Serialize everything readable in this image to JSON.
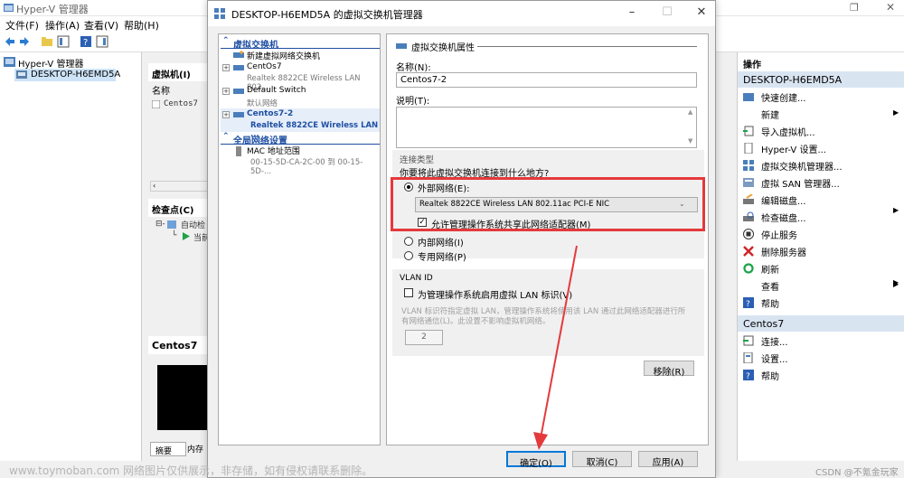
{
  "bg_window": {
    "title": "Hyper-V 管理器",
    "menu": [
      "文件(F)",
      "操作(A)",
      "查看(V)",
      "帮助(H)"
    ],
    "tree_root": "Hyper-V 管理器",
    "tree_host": "DESKTOP-H6EMD5A",
    "vm_panel_title": "虚拟机(I)",
    "vm_col_name": "名称",
    "vm_row": "Centos7",
    "checkpoint_title": "检查点(C)",
    "checkpoint_item": "自动检",
    "checkpoint_sub": "当前",
    "detail_title": "Centos7",
    "detail_tab1": "摘要",
    "detail_tab2": "内存"
  },
  "actions": {
    "header": "操作",
    "host_header": "DESKTOP-H6EMD5A",
    "host_items": [
      "快速创建...",
      "新建",
      "导入虚拟机...",
      "Hyper-V 设置...",
      "虚拟交换机管理器...",
      "虚拟 SAN 管理器...",
      "编辑磁盘...",
      "检查磁盘...",
      "停止服务",
      "删除服务器",
      "刷新",
      "查看",
      "帮助"
    ],
    "vm_header": "Centos7",
    "vm_items": [
      "连接...",
      "设置...",
      "帮助"
    ]
  },
  "dialog": {
    "title": "DESKTOP-H6EMD5A 的虚拟交换机管理器",
    "left": {
      "group1": "虚拟交换机",
      "new_switch": "新建虚拟网络交换机",
      "sw1_name": "CentOs7",
      "sw1_sub": "Realtek 8822CE Wireless LAN 802....",
      "sw2_name": "Default Switch",
      "sw2_sub": "默认网络",
      "sw3_name": "Centos7-2",
      "sw3_sub": "Realtek 8822CE Wireless LAN ...",
      "group2": "全局网络设置",
      "mac_name": "MAC 地址范围",
      "mac_sub": "00-15-5D-CA-2C-00 到 00-15-5D-..."
    },
    "right": {
      "section_title": "虚拟交换机属性",
      "name_label": "名称(N):",
      "name_value": "Centos7-2",
      "notes_label": "说明(T):",
      "conn_type_label": "连接类型",
      "conn_question": "你要将此虚拟交换机连接到什么地方?",
      "external_label": "外部网络(E):",
      "adapter_value": "Realtek 8822CE Wireless LAN 802.11ac PCI-E NIC",
      "allow_share_label": "允许管理操作系统共享此网络适配器(M)",
      "internal_label": "内部网络(I)",
      "private_label": "专用网络(P)",
      "vlan_label": "VLAN ID",
      "vlan_check_label": "为管理操作系统启用虚拟 LAN 标识(V)",
      "vlan_desc": "VLAN 标识符指定虚拟 LAN，管理操作系统将使用该 LAN 通过此网络适配器进行所有网络通信(L)。此设置不影响虚拟机网络。",
      "vlan_value": "2",
      "remove_label": "移除(R)"
    },
    "buttons": {
      "ok": "确定(O)",
      "cancel": "取消(C)",
      "apply": "应用(A)"
    }
  },
  "overlay": {
    "watermark": "www.toymoban.com 网络图片仅供展示，非存储，如有侵权请联系删除。",
    "csdn": "CSDN @不氪金玩家"
  },
  "colors": {
    "highlight_red": "#e5393b",
    "link_blue": "#1f4fa3"
  }
}
